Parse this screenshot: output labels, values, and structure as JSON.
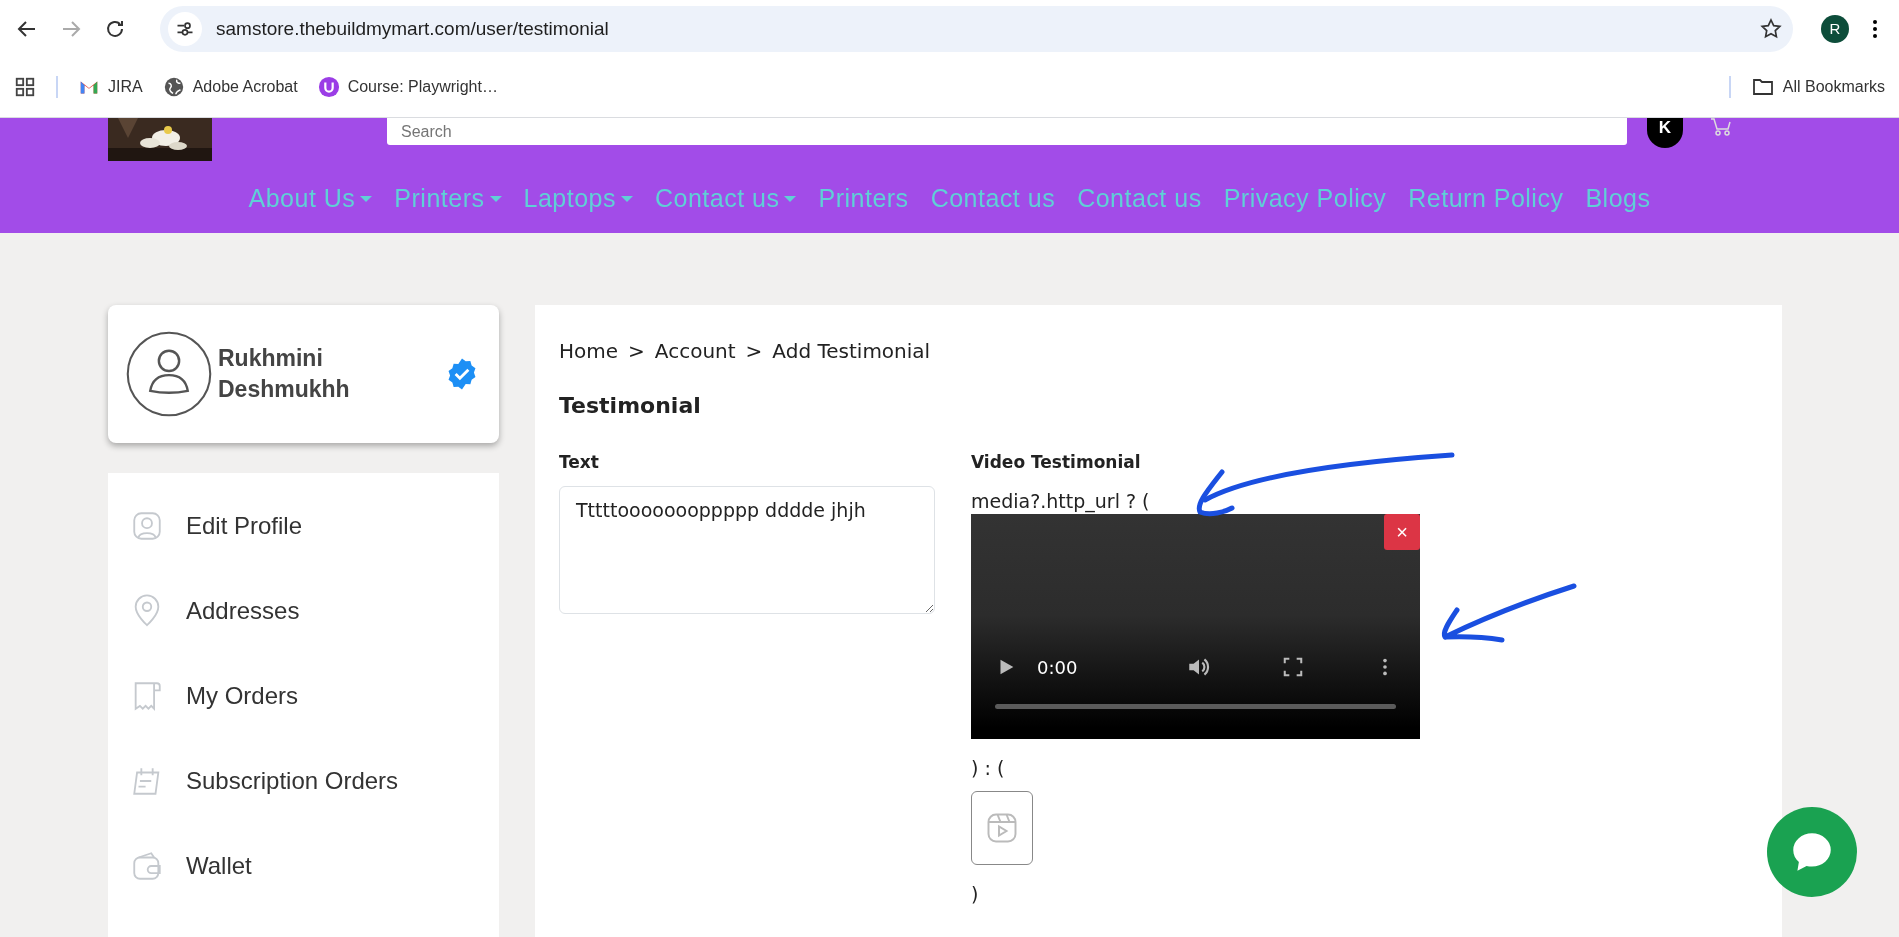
{
  "browser": {
    "url": "samstore.thebuildmymart.com/user/testimonial",
    "profile_initial": "R",
    "bookmarks": [
      {
        "label": "JIRA"
      },
      {
        "label": "Adobe Acrobat"
      },
      {
        "label": "Course: Playwright…"
      }
    ],
    "all_bookmarks": "All Bookmarks"
  },
  "header": {
    "search_placeholder": "Search",
    "user_initial": "K",
    "nav": [
      {
        "label": "About Us",
        "dropdown": true
      },
      {
        "label": "Printers",
        "dropdown": true
      },
      {
        "label": "Laptops",
        "dropdown": true
      },
      {
        "label": "Contact us",
        "dropdown": true
      },
      {
        "label": "Printers",
        "dropdown": false
      },
      {
        "label": "Contact us",
        "dropdown": false
      },
      {
        "label": "Contact us",
        "dropdown": false
      },
      {
        "label": "Privacy Policy",
        "dropdown": false
      },
      {
        "label": "Return Policy",
        "dropdown": false
      },
      {
        "label": "Blogs",
        "dropdown": false
      }
    ]
  },
  "profile": {
    "name": "Rukhmini Deshmukhh",
    "verified": true
  },
  "sidebar": {
    "items": [
      {
        "label": "Edit Profile"
      },
      {
        "label": "Addresses"
      },
      {
        "label": "My Orders"
      },
      {
        "label": "Subscription Orders"
      },
      {
        "label": "Wallet"
      }
    ]
  },
  "main": {
    "breadcrumb": {
      "items": [
        "Home",
        "Account",
        "Add Testimonial"
      ],
      "separator": ">"
    },
    "title": "Testimonial",
    "text_label": "Text",
    "text_value": "Tttttoooooooppppp dddde jhjh",
    "video_label": "Video Testimonial",
    "code_open": "media?.http_url ? (",
    "video": {
      "time": "0:00",
      "level": 0,
      "close": "×"
    },
    "code_else": ") : (",
    "code_close": ")"
  }
}
